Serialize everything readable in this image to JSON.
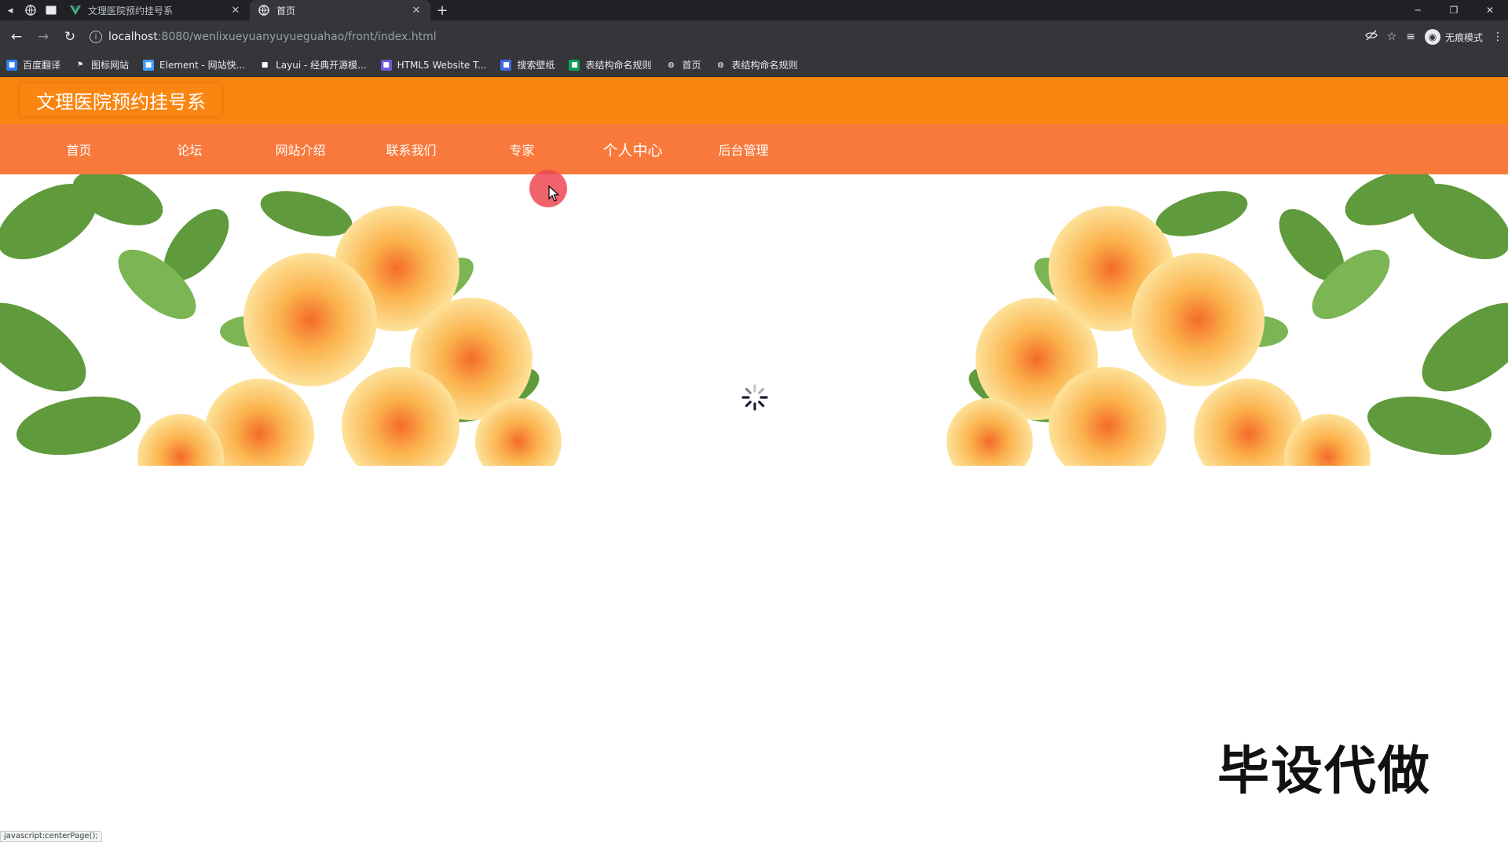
{
  "browser": {
    "tabs": [
      {
        "title": "文理医院预约挂号系",
        "active": false,
        "favicon": "vue-logo-icon"
      },
      {
        "title": "首页",
        "active": true,
        "favicon": "globe-icon"
      }
    ],
    "new_tab_symbol": "+",
    "url_host": "localhost",
    "url_path": ":8080/wenlixueyuanyuyueguahao/front/index.html",
    "profile_label": "无痕模式",
    "bookmarks": [
      {
        "label": "百度翻译",
        "icon": "baidu-translate-icon",
        "color": "#2d7df6"
      },
      {
        "label": "图标网站",
        "icon": "flag-icon",
        "color": "#35363a"
      },
      {
        "label": "Element - 网站快...",
        "icon": "element-icon",
        "color": "#409eff"
      },
      {
        "label": "Layui - 经典开源模...",
        "icon": "layui-icon",
        "color": "#35363a"
      },
      {
        "label": "HTML5 Website T...",
        "icon": "html5-template-icon",
        "color": "#6b5bd6"
      },
      {
        "label": "搜索壁纸",
        "icon": "wallpaper-icon",
        "color": "#4169e1"
      },
      {
        "label": "表结构命名规则",
        "icon": "sheet-icon",
        "color": "#0f9d58"
      },
      {
        "label": "首页",
        "icon": "globe-icon",
        "color": "#35363a"
      },
      {
        "label": "表结构命名规则",
        "icon": "globe-icon",
        "color": "#35363a"
      }
    ]
  },
  "site": {
    "title": "文理医院预约挂号系",
    "colors": {
      "header": "#fb8511",
      "nav": "#f9793c"
    },
    "nav": [
      {
        "label": "首页"
      },
      {
        "label": "论坛"
      },
      {
        "label": "网站介绍"
      },
      {
        "label": "联系我们"
      },
      {
        "label": "专家"
      },
      {
        "label": "个人中心"
      },
      {
        "label": "后台管理"
      }
    ]
  },
  "watermark": "毕设代做",
  "status_text": "javascript:centerPage();"
}
